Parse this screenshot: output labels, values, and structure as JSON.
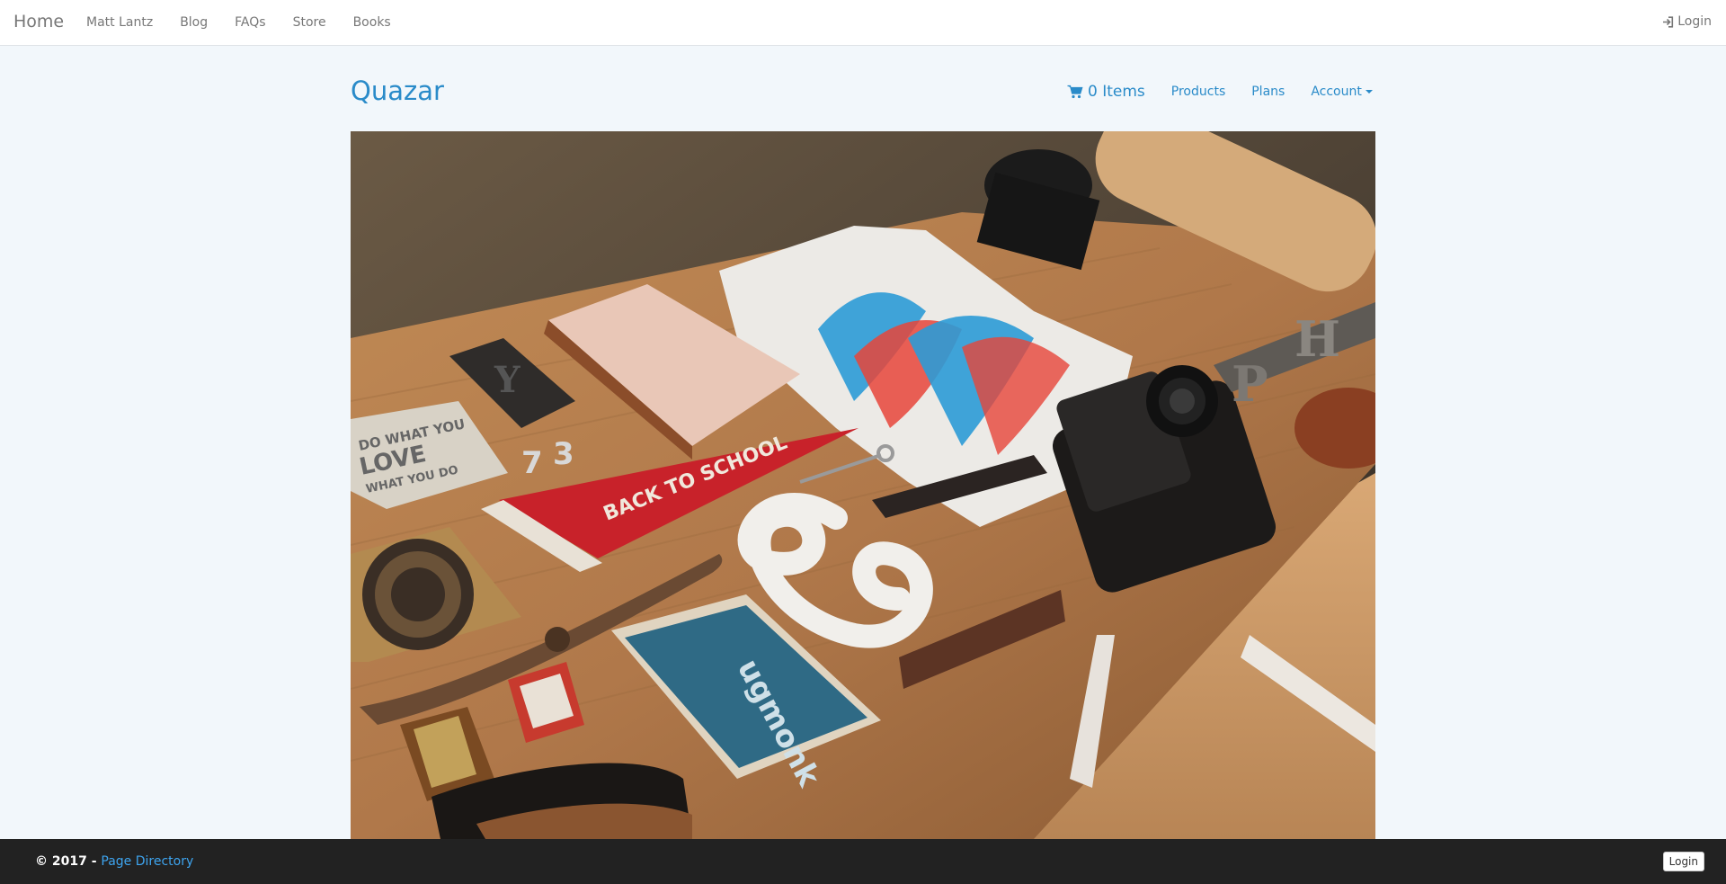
{
  "topnav": {
    "brand": "Home",
    "links": [
      "Matt Lantz",
      "Blog",
      "FAQs",
      "Store",
      "Books"
    ],
    "login": "Login"
  },
  "header": {
    "site_title": "Quazar",
    "cart_label": "0 Items",
    "products": "Products",
    "plans": "Plans",
    "account": "Account"
  },
  "hero": {
    "pennant_text": "BACK TO SCHOOL",
    "card_text": "DO WHAT YOU LOVE LOVE WHAT YOU DO",
    "box_text": "ugmonk"
  },
  "footer": {
    "copyright": "© 2017 - ",
    "page_directory": "Page Directory",
    "login_button": "Login"
  },
  "colors": {
    "accent": "#2a8bc9",
    "footer_bg": "#222222",
    "page_bg": "#f2f7fb"
  }
}
